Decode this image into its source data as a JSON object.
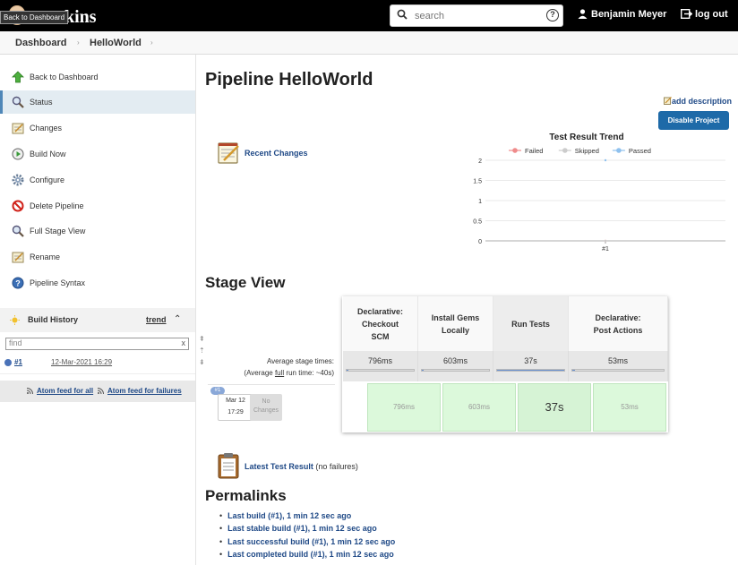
{
  "header": {
    "logo_word": "kins",
    "logo_tooltip": "Back to Dashboard",
    "search_placeholder": "search",
    "help_glyph": "?",
    "user_name": "Benjamin Meyer",
    "logout_label": "log out"
  },
  "breadcrumb": {
    "items": [
      "Dashboard",
      "HelloWorld"
    ]
  },
  "sidebar": {
    "tasks": [
      {
        "label": "Back to Dashboard",
        "icon": "arrow-up-icon"
      },
      {
        "label": "Status",
        "icon": "magnifier-icon",
        "selected": true
      },
      {
        "label": "Changes",
        "icon": "notepad-icon"
      },
      {
        "label": "Build Now",
        "icon": "clock-play-icon"
      },
      {
        "label": "Configure",
        "icon": "gear-icon"
      },
      {
        "label": "Delete Pipeline",
        "icon": "no-entry-icon"
      },
      {
        "label": "Full Stage View",
        "icon": "magnifier-icon"
      },
      {
        "label": "Rename",
        "icon": "notepad-icon"
      },
      {
        "label": "Pipeline Syntax",
        "icon": "help-icon"
      }
    ],
    "build_history": {
      "title": "Build History",
      "trend_label": "trend",
      "find_placeholder": "find",
      "clear_glyph": "x",
      "builds": [
        {
          "number": "#1",
          "date": "12-Mar-2021 16:29"
        }
      ],
      "feed_all": "Atom feed for all",
      "feed_failures": "Atom feed for failures"
    }
  },
  "main": {
    "title": "Pipeline HelloWorld",
    "add_description": "add description",
    "disable_button": "Disable Project",
    "recent_changes": "Recent Changes",
    "stage_view_title": "Stage View",
    "stages": [
      {
        "name_lines": [
          "Declarative:",
          "Checkout",
          "SCM"
        ],
        "avg": "796ms",
        "avg_fraction": 0.0,
        "cell": "796ms"
      },
      {
        "name_lines": [
          "Install Gems",
          "Locally"
        ],
        "avg": "603ms",
        "avg_fraction": 0.0,
        "cell": "603ms"
      },
      {
        "name_lines": [
          "Run Tests"
        ],
        "avg": "37s",
        "avg_fraction": 1.0,
        "cell": "37s"
      },
      {
        "name_lines": [
          "Declarative:",
          "Post Actions"
        ],
        "avg": "53ms",
        "avg_fraction": 0.0,
        "cell": "53ms"
      }
    ],
    "avg_stage_label": "Average stage times:",
    "avg_run_prefix": "(Average ",
    "avg_run_full": "full",
    "avg_run_suffix": " run time: ~40s)",
    "run": {
      "badge": "#1",
      "date": "Mar 12",
      "time": "17:29",
      "no_changes_1": "No",
      "no_changes_2": "Changes"
    },
    "latest_test_result": "Latest Test Result",
    "latest_test_result_note": "(no failures)",
    "permalinks_title": "Permalinks",
    "permalinks": [
      "Last build (#1), 1 min 12 sec ago",
      "Last stable build (#1), 1 min 12 sec ago",
      "Last successful build (#1), 1 min 12 sec ago",
      "Last completed build (#1), 1 min 12 sec ago"
    ]
  },
  "chart_data": {
    "type": "line",
    "title": "Test Result Trend",
    "categories": [
      "#1"
    ],
    "series": [
      {
        "name": "Failed",
        "values": [
          0
        ],
        "color": "#ef8b8b"
      },
      {
        "name": "Skipped",
        "values": [
          0
        ],
        "color": "#cccccc"
      },
      {
        "name": "Passed",
        "values": [
          2
        ],
        "color": "#8fc1ee"
      }
    ],
    "ylim": [
      0,
      2
    ],
    "yticks": [
      "0",
      "0.5",
      "1",
      "1.5",
      "2"
    ],
    "legend": "top",
    "grid": true
  }
}
